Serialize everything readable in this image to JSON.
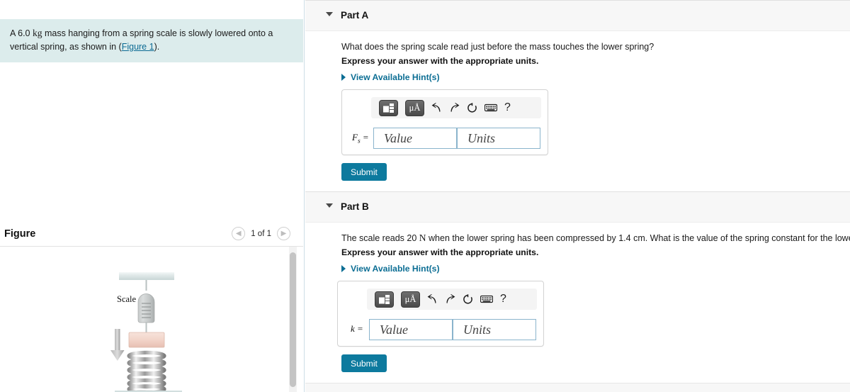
{
  "problem": {
    "text_before_unit": "A 6.0 ",
    "unit": "kg",
    "text_after_unit": " mass hanging from a spring scale is slowly lowered onto a vertical spring, as shown in (",
    "figure_link": "Figure 1",
    "text_end": ")."
  },
  "figure_panel": {
    "title": "Figure",
    "counter": "1 of 1",
    "prev_icon": "chevron-left-icon",
    "next_icon": "chevron-right-icon",
    "diagram_label_scale": "Scale"
  },
  "parts": [
    {
      "id": "part-a",
      "title": "Part A",
      "question_pre": "What does the spring scale read just before the mass touches the lower spring?",
      "question_unit": "",
      "question_post": "",
      "express": "Express your answer with the appropriate units.",
      "hint_label": "View Available Hint(s)",
      "answer_symbol": "F",
      "answer_subscript": "s",
      "answer_equals": " =",
      "value_placeholder": "Value",
      "units_placeholder": "Units",
      "submit_label": "Submit"
    },
    {
      "id": "part-b",
      "title": "Part B",
      "question_pre": "The scale reads 20 ",
      "question_unit": "N",
      "question_post": " when the lower spring has been compressed by 1.4 cm. What is the value of the spring constant for the lower spring?",
      "express": "Express your answer with the appropriate units.",
      "hint_label": "View Available Hint(s)",
      "answer_symbol": "k",
      "answer_subscript": "",
      "answer_equals": " =",
      "value_placeholder": "Value",
      "units_placeholder": "Units",
      "submit_label": "Submit"
    }
  ],
  "toolbar": {
    "template_icon": "math-template-icon",
    "units_icon": "micro-angstrom-units-icon",
    "units_label": "μÅ",
    "undo_icon": "undo-arrow-icon",
    "undo_glyph": "↰",
    "redo_icon": "redo-arrow-icon",
    "redo_glyph": "↱",
    "reset_icon": "reset-circular-arrow-icon",
    "reset_glyph": "↺",
    "keyboard_icon": "keyboard-icon",
    "help_icon": "help-question-icon",
    "help_glyph": "?"
  },
  "colors": {
    "problem_background": "#dcecec",
    "link": "#0b6a93",
    "submit": "#0d7a9e",
    "part_header_background": "#f7f7f7",
    "field_border": "#8ab4cc",
    "mass_block": "#f3d8cf"
  }
}
